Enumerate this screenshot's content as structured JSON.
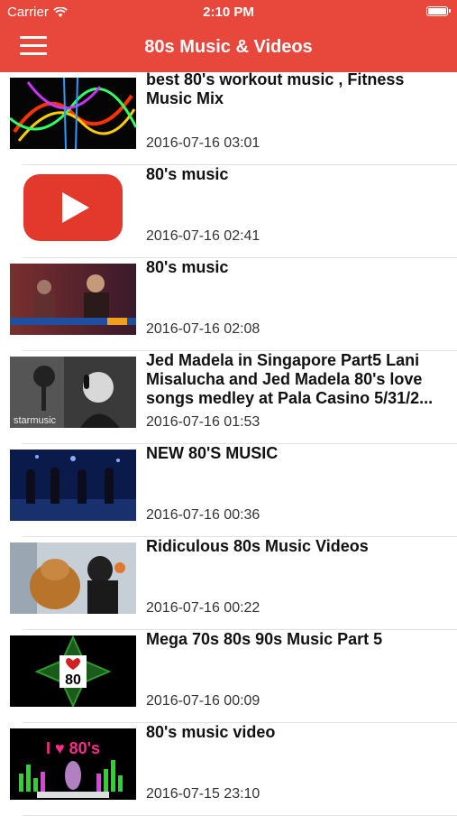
{
  "status": {
    "carrier": "Carrier",
    "time": "2:10 PM"
  },
  "nav": {
    "title": "80s Music & Videos"
  },
  "videos": [
    {
      "title": "best 80's workout music , Fitness Music Mix",
      "date": "2016-07-16 03:01"
    },
    {
      "title": "80's music",
      "date": "2016-07-16 02:41"
    },
    {
      "title": "80's music",
      "date": "2016-07-16 02:08"
    },
    {
      "title": "Jed Madela in Singapore Part5 Lani Misalucha and Jed Madela 80's love songs medley at Pala Casino 5/31/2...",
      "date": "2016-07-16 01:53"
    },
    {
      "title": "NEW 80'S MUSIC",
      "date": "2016-07-16 00:36"
    },
    {
      "title": "Ridiculous 80s Music Videos",
      "date": "2016-07-16 00:22"
    },
    {
      "title": "Mega 70s 80s 90s Music Part 5",
      "date": "2016-07-16 00:09"
    },
    {
      "title": "80's music video",
      "date": "2016-07-15 23:10"
    }
  ],
  "thumbs": {
    "starmusic": "starmusic",
    "i80": "80",
    "ilove": "I ♥ 80's"
  }
}
